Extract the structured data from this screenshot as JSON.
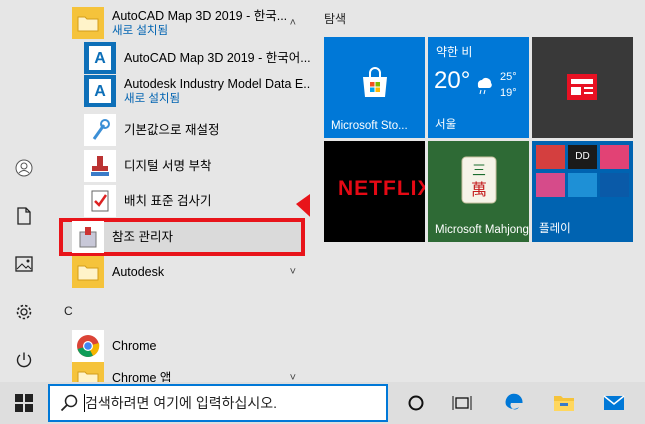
{
  "app_list": {
    "rows": [
      {
        "label": "AutoCAD Map 3D 2019 - 한국...",
        "sub": "새로 설치됨"
      },
      {
        "label": "AutoCAD Map 3D 2019 - 한국어..."
      },
      {
        "label": "Autodesk Industry Model Data E...",
        "sub": "새로 설치됨"
      },
      {
        "label": "기본값으로 재설정"
      },
      {
        "label": "디지털 서명 부착"
      },
      {
        "label": "배치 표준 검사기"
      },
      {
        "label": "참조 관리자"
      },
      {
        "label": "Autodesk"
      },
      {
        "label": "Chrome"
      },
      {
        "label": "Chrome 앱"
      }
    ],
    "section_letter_c": "C"
  },
  "tiles": {
    "group_title": "탐색",
    "microsoft_store": "Microsoft Sto...",
    "weather": {
      "condition": "약한 비",
      "temp": "20°",
      "high": "25°",
      "low": "19°",
      "city": "서울"
    },
    "netflix": "NETFLIX",
    "mahjong": "Microsoft Mahjong",
    "play": "플레이"
  },
  "taskbar": {
    "search_placeholder": "검색하려면 여기에 입력하십시오."
  },
  "colors": {
    "accent": "#0078d7",
    "highlight": "#e8141a"
  }
}
